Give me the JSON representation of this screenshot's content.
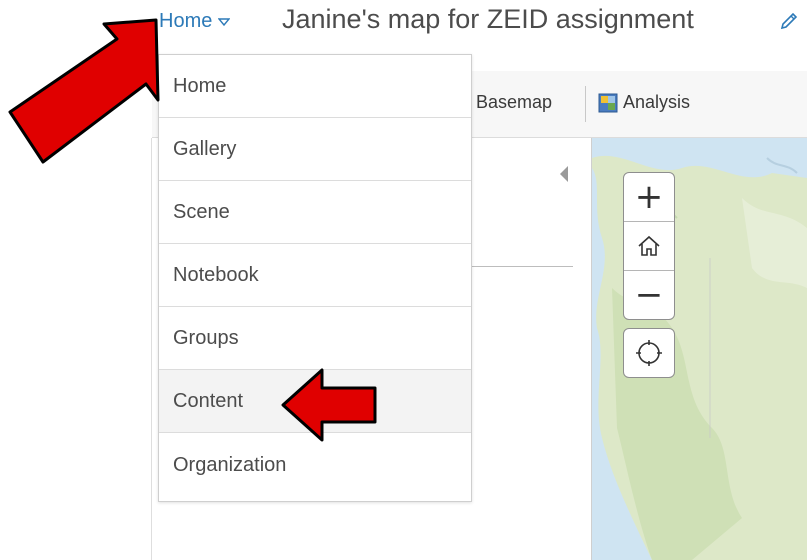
{
  "header": {
    "home_label": "Home",
    "home_caret_icon": "caret-down-icon",
    "map_title": "Janine's map for ZEID assignment",
    "edit_icon": "pencil-icon"
  },
  "toolbar": {
    "basemap_label": "Basemap",
    "analysis_label": "Analysis",
    "analysis_icon": "analysis-icon"
  },
  "menu": {
    "items": [
      {
        "label": "Home"
      },
      {
        "label": "Gallery"
      },
      {
        "label": "Scene"
      },
      {
        "label": "Notebook"
      },
      {
        "label": "Groups"
      },
      {
        "label": "Content"
      },
      {
        "label": "Organization"
      }
    ],
    "highlighted": "Content"
  },
  "map_controls": {
    "zoom_in": "+",
    "zoom_out": "−",
    "home_icon": "house-icon",
    "locate_icon": "locate-icon"
  },
  "colors": {
    "link": "#2d7ab8",
    "annotation_arrow": "#e00000",
    "ocean": "#cfe4f2",
    "land": "#dde8c8"
  }
}
